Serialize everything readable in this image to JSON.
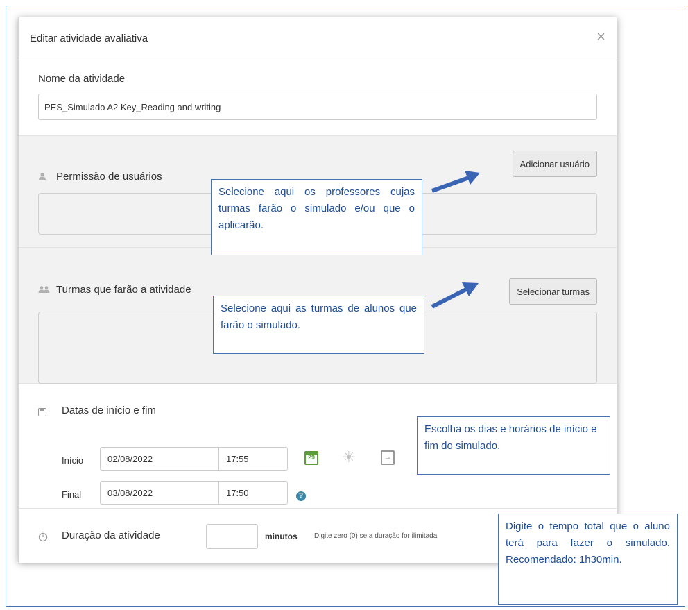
{
  "modal": {
    "title": "Editar atividade avaliativa",
    "close_glyph": "×"
  },
  "nome": {
    "label": "Nome da atividade",
    "value": "PES_Simulado A2 Key_Reading and writing"
  },
  "permissao": {
    "icon": "person-icon",
    "label": "Permissão de usuários",
    "button_label": "Adicionar usuário"
  },
  "turmas": {
    "icon": "group-icon",
    "label": "Turmas que farão a atividade",
    "button_label": "Selecionar turmas"
  },
  "datas": {
    "label": "Datas de início e fim",
    "inicio_label": "Início",
    "inicio_date": "02/08/2022",
    "inicio_time": "17:55",
    "final_label": "Final",
    "final_date": "03/08/2022",
    "final_time": "17:50",
    "calendar_day": "29",
    "help_glyph": "?"
  },
  "duracao": {
    "label": "Duração da atividade",
    "value": "",
    "unit": "minutos",
    "hint": "Digite zero (0) se a duração for ilimitada"
  },
  "callouts": {
    "professores": "Selecione aqui os professores cujas turmas farão o simulado e/ou que o aplicarão.",
    "turmas": "Selecione aqui as turmas de alunos que farão o simulado.",
    "datas": "Escolha os dias e horários de início e fim do simulado.",
    "duracao": "Digite o tempo total que o aluno terá para fazer o simulado. Recomendado: 1h30min."
  },
  "colors": {
    "callout_border": "#4a72b0",
    "callout_text": "#1f4e96",
    "arrow": "#3a65b5",
    "section_gray": "#f2f2f2",
    "calendar_green": "#5a9e3a",
    "help_blue": "#3d87a8"
  }
}
